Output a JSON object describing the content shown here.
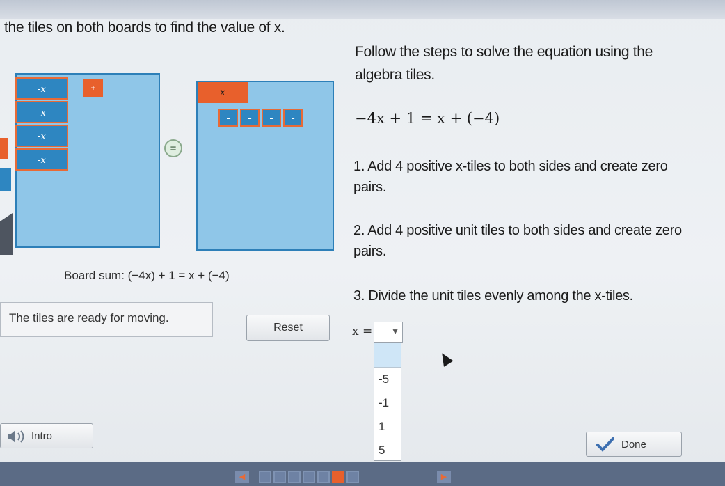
{
  "instruction": "the tiles on both boards to find the value of x.",
  "steps_title": "Follow the steps to solve the equation using the algebra tiles.",
  "equation": "−4x + 1 = x + (−4)",
  "steps": [
    "1. Add 4 positive x-tiles to both sides and create zero pairs.",
    "2. Add 4 positive unit tiles to both sides and create zero pairs.",
    "3. Divide the unit tiles evenly among the x-tiles."
  ],
  "left_board": {
    "neg_x_tiles": [
      "-x",
      "-x",
      "-x",
      "-x"
    ],
    "pos_unit_tile": "+"
  },
  "right_board": {
    "pos_x_tile": "x",
    "neg_unit_tiles": [
      "-",
      "-",
      "-",
      "-"
    ]
  },
  "equals_symbol": "=",
  "board_sum": "Board sum: (−4x) + 1 = x + (−4)",
  "status_message": "The tiles are ready for moving.",
  "reset_label": "Reset",
  "answer": {
    "label": "x =",
    "selected": "",
    "options": [
      "",
      "-5",
      "-1",
      "1",
      "5"
    ]
  },
  "intro_label": "Intro",
  "done_label": "Done",
  "progress": {
    "total": 7,
    "current": 6
  },
  "colors": {
    "board": "#8fc6e8",
    "negative_tile": "#2e86c1",
    "positive_tile": "#e8602c",
    "footer": "#5b6b85"
  },
  "icons": {
    "intro": "speaker-icon",
    "done": "checkmark-icon",
    "select": "chevron-down-icon"
  }
}
